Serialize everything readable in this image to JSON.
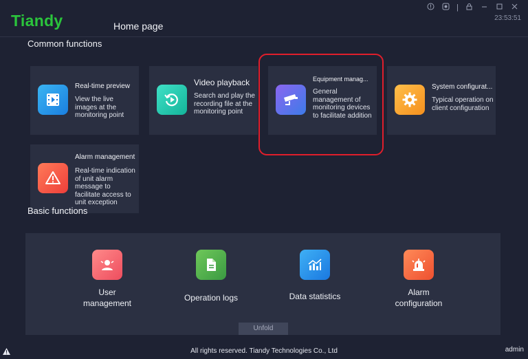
{
  "app": {
    "logo": "Tiandy",
    "home_tab": "Home page",
    "clock": "23:53:51"
  },
  "window_controls": [
    "info-icon",
    "record-icon",
    "lock-icon",
    "minimize-icon",
    "maximize-icon",
    "close-icon"
  ],
  "common": {
    "title": "Common functions",
    "cards": [
      {
        "title": "Real-time preview",
        "desc": "View the live images at the monitoring point",
        "icon": "play-video-icon"
      },
      {
        "title": "Video playback",
        "desc": "Search and play the recording file at the monitoring point",
        "icon": "playback-icon"
      },
      {
        "title": "Equipment manag...",
        "desc": "General management of monitoring devices to facilitate addition",
        "icon": "camera-icon"
      },
      {
        "title": "System configurat...",
        "desc": "Typical operation on client configuration",
        "icon": "gear-icon"
      },
      {
        "title": "Alarm management",
        "desc": "Real-time indication of unit alarm message to facilitate access to unit exception",
        "icon": "warning-icon"
      }
    ]
  },
  "basic": {
    "title": "Basic functions",
    "items": [
      {
        "label": "User management",
        "icon": "user-icon"
      },
      {
        "label": "Operation logs",
        "icon": "document-icon"
      },
      {
        "label": "Data statistics",
        "icon": "chart-icon"
      },
      {
        "label": "Alarm configuration",
        "icon": "alarm-light-icon"
      }
    ],
    "unfold": "Unfold"
  },
  "footer": {
    "copyright": "All rights reserved. Tiandy Technologies Co., Ltd",
    "user": "admin"
  },
  "colors": {
    "background": "#1e2233",
    "card": "#2a2f41",
    "logo": "#2bc43c",
    "highlight": "#e01e2b"
  }
}
